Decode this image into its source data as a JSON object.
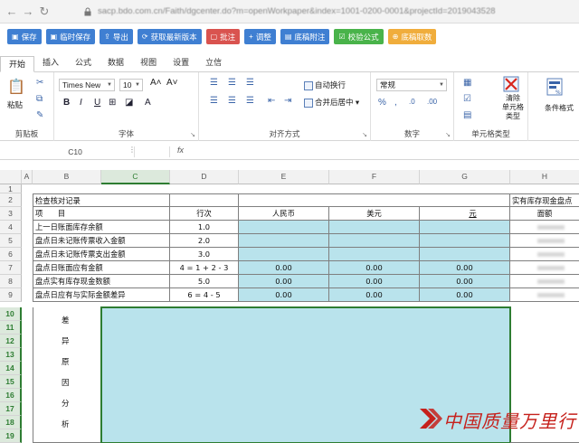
{
  "browser": {
    "url": "sacp.bdo.com.cn/Faith/dgcenter.do?m=openWorkpaper&index=1001-0200-0001&projectId=2019043528"
  },
  "actions": [
    {
      "label": "保存",
      "icon": "save-icon",
      "color": "blue"
    },
    {
      "label": "临时保存",
      "icon": "save-icon",
      "color": "blue"
    },
    {
      "label": "导出",
      "icon": "export-icon",
      "color": "blue"
    },
    {
      "label": "获取最新版本",
      "icon": "refresh-icon",
      "color": "blue"
    },
    {
      "label": "批注",
      "icon": "note-icon",
      "color": "red"
    },
    {
      "label": "调整",
      "icon": "plus-icon",
      "color": "blue"
    },
    {
      "label": "底稿附注",
      "icon": "doc-icon",
      "color": "blue"
    },
    {
      "label": "校验公式",
      "icon": "check-icon",
      "color": "green"
    },
    {
      "label": "底稿取数",
      "icon": "fetch-icon",
      "color": "orange"
    }
  ],
  "tabs": [
    "开始",
    "插入",
    "公式",
    "数据",
    "视图",
    "设置",
    "立信"
  ],
  "ribbon": {
    "clipboard": {
      "label": "剪贴板",
      "paste": "粘贴"
    },
    "font": {
      "label": "字体",
      "font_name": "Times New",
      "font_size": "10"
    },
    "alignment": {
      "label": "对齐方式",
      "wrap": "自动换行",
      "merge": "合并后居中"
    },
    "number": {
      "label": "数字",
      "format": "常规"
    },
    "cell_style": {
      "label": "单元格类型",
      "clear": "清除\n单元格\n类型",
      "condition": "条件格式"
    }
  },
  "formula_bar": {
    "name_box": "C10",
    "fx": "fx"
  },
  "columns": [
    "A",
    "B",
    "C",
    "D",
    "E",
    "F",
    "G",
    "H"
  ],
  "rows": [
    "1",
    "2",
    "3",
    "4",
    "5",
    "6",
    "7",
    "8",
    "9",
    "10",
    "11",
    "12",
    "13",
    "14",
    "15",
    "16",
    "17",
    "18",
    "19"
  ],
  "sheet": {
    "row2": {
      "b": "检查核对记录",
      "h": "实有库存现金盘点"
    },
    "row3": {
      "b": "项　　目",
      "d": "行次",
      "e": "人民币",
      "f": "美元",
      "g": "元",
      "h": "面额"
    },
    "data_rows": [
      {
        "label": "上一日账面库存余额",
        "line": "1.0",
        "e": "",
        "f": "",
        "g": ""
      },
      {
        "label": "盘点日未记账传票收入金额",
        "line": "2.0",
        "e": "",
        "f": "",
        "g": ""
      },
      {
        "label": "盘点日未记账传票支出金额",
        "line": "3.0",
        "e": "",
        "f": "",
        "g": ""
      },
      {
        "label": "盘点日账面应有金额",
        "line": "4 = 1 + 2 - 3",
        "e": "0.00",
        "f": "0.00",
        "g": "0.00"
      },
      {
        "label": "盘点实有库存现金数额",
        "line": "5.0",
        "e": "0.00",
        "f": "0.00",
        "g": "0.00"
      },
      {
        "label": "盘点日应有与实际金额差异",
        "line": "6 = 4 - 5",
        "e": "0.00",
        "f": "0.00",
        "g": "0.00"
      }
    ],
    "diff_analysis_chars": [
      "差",
      "异",
      "原",
      "因",
      "分",
      "析"
    ]
  },
  "watermark": {
    "text": "中国质量万里行"
  },
  "colors": {
    "cell_fill": "#b9e3ec",
    "selection": "#2e7d32",
    "brand_red": "#c6211c"
  }
}
